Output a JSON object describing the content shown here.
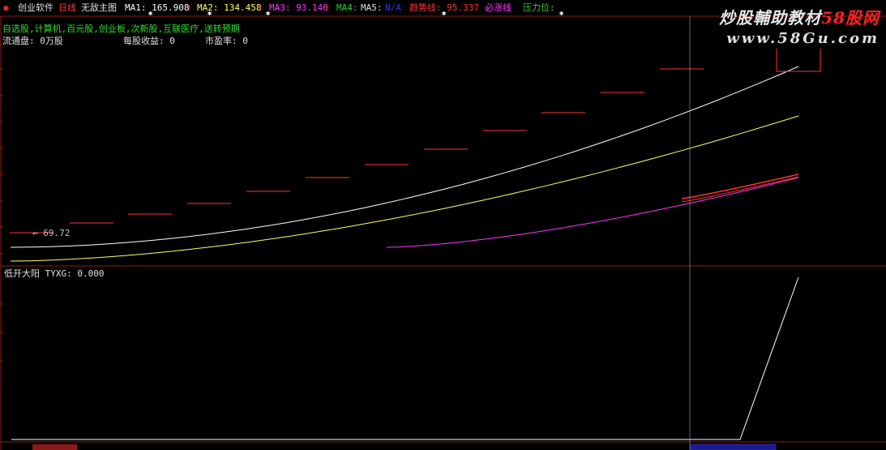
{
  "header": {
    "software": "创业软件",
    "period": "日线",
    "indicator_name": "无敌主图",
    "ma1": "MA1: 165.908",
    "ma2": "MA2: 134.458",
    "ma3": "MA3: 93.146",
    "ma4": "MA4:",
    "ma5": "MA5:",
    "ma5_value": "N/A",
    "trend_line": "趋势线: 95.337",
    "must_rise": "必涨线",
    "pressure": "压力位:",
    "up_arrow": "↑"
  },
  "stock_info": {
    "concepts": "自选股,计算机,百元股,创业板,次新股,互联医疗,送转预期",
    "float_shares": "流通盘: 0万股",
    "eps": "每股收益: 0",
    "pe": "市盈率: 0"
  },
  "price_low_marker": "← 69.72",
  "lower_panel": {
    "title": "低开大阳 TYXG: 0.000"
  },
  "watermark": {
    "line1_text": "炒股輔助教材",
    "line1_red": "58股网",
    "line2": "www.58Gu.com"
  },
  "colors": {
    "ma1": "#ffffff",
    "ma2": "#ffff66",
    "ma3": "#ff33ff",
    "trend": "#ff3333",
    "panel_border": "#8b1a1a",
    "step": "#ff3333"
  },
  "chart_data": {
    "type": "line",
    "x": [
      1,
      2,
      3,
      4,
      5,
      6,
      7,
      8,
      9,
      10,
      11,
      12,
      13,
      14
    ],
    "series": [
      {
        "name": "MA1",
        "values": [
          null,
          null,
          null,
          null,
          null,
          null,
          null,
          null,
          null,
          null,
          null,
          null,
          null,
          165.908
        ]
      },
      {
        "name": "MA2",
        "values": [
          null,
          null,
          null,
          null,
          null,
          null,
          null,
          null,
          null,
          null,
          null,
          null,
          null,
          134.458
        ]
      },
      {
        "name": "MA3",
        "values": [
          null,
          null,
          null,
          null,
          null,
          null,
          null,
          null,
          null,
          null,
          null,
          null,
          null,
          93.146
        ]
      },
      {
        "name": "趋势线",
        "values": [
          null,
          null,
          null,
          null,
          null,
          null,
          null,
          null,
          null,
          null,
          null,
          null,
          null,
          95.337
        ]
      }
    ],
    "annotations": [
      "← 69.72"
    ],
    "lower_series": {
      "name": "TYXG",
      "values": [
        0,
        0,
        0,
        0,
        0,
        0,
        0,
        0,
        0,
        0,
        0,
        0,
        0,
        1
      ]
    }
  }
}
